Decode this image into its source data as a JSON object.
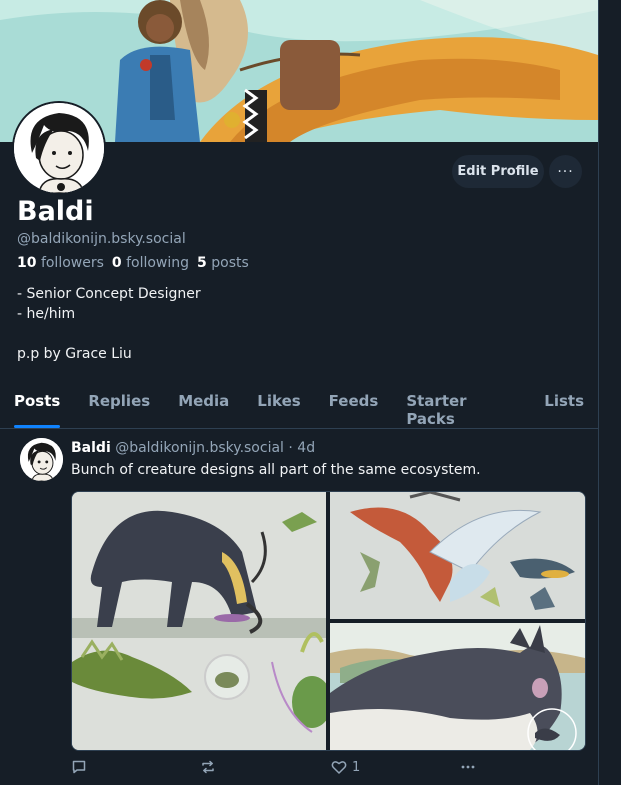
{
  "profile": {
    "name": "Baldi",
    "handle": "@baldikonijn.bsky.social",
    "followers_count": "10",
    "followers_label": "followers",
    "following_count": "0",
    "following_label": "following",
    "posts_count": "5",
    "posts_label": "posts",
    "bio": [
      "- Senior Concept Designer",
      "- he/him",
      "",
      "p.p by Grace Liu"
    ],
    "edit_label": "Edit Profile",
    "more_label": "···"
  },
  "tabs": [
    "Posts",
    "Replies",
    "Media",
    "Likes",
    "Feeds",
    "Starter Packs",
    "Lists"
  ],
  "active_tab": "Posts",
  "post": {
    "author": "Baldi",
    "handle": "@baldikonijn.bsky.social",
    "separator": "·",
    "time": "4d",
    "text": "Bunch of creature designs all part of the same ecosystem.",
    "like_count": "1",
    "reply_count": "",
    "repost_count": ""
  },
  "colors": {
    "background": "#161e27",
    "accent": "#1083fe",
    "muted_text": "#93a5b7",
    "button_bg": "#1e2936"
  },
  "icons": [
    "reply-icon",
    "repost-icon",
    "like-icon",
    "more-icon"
  ]
}
